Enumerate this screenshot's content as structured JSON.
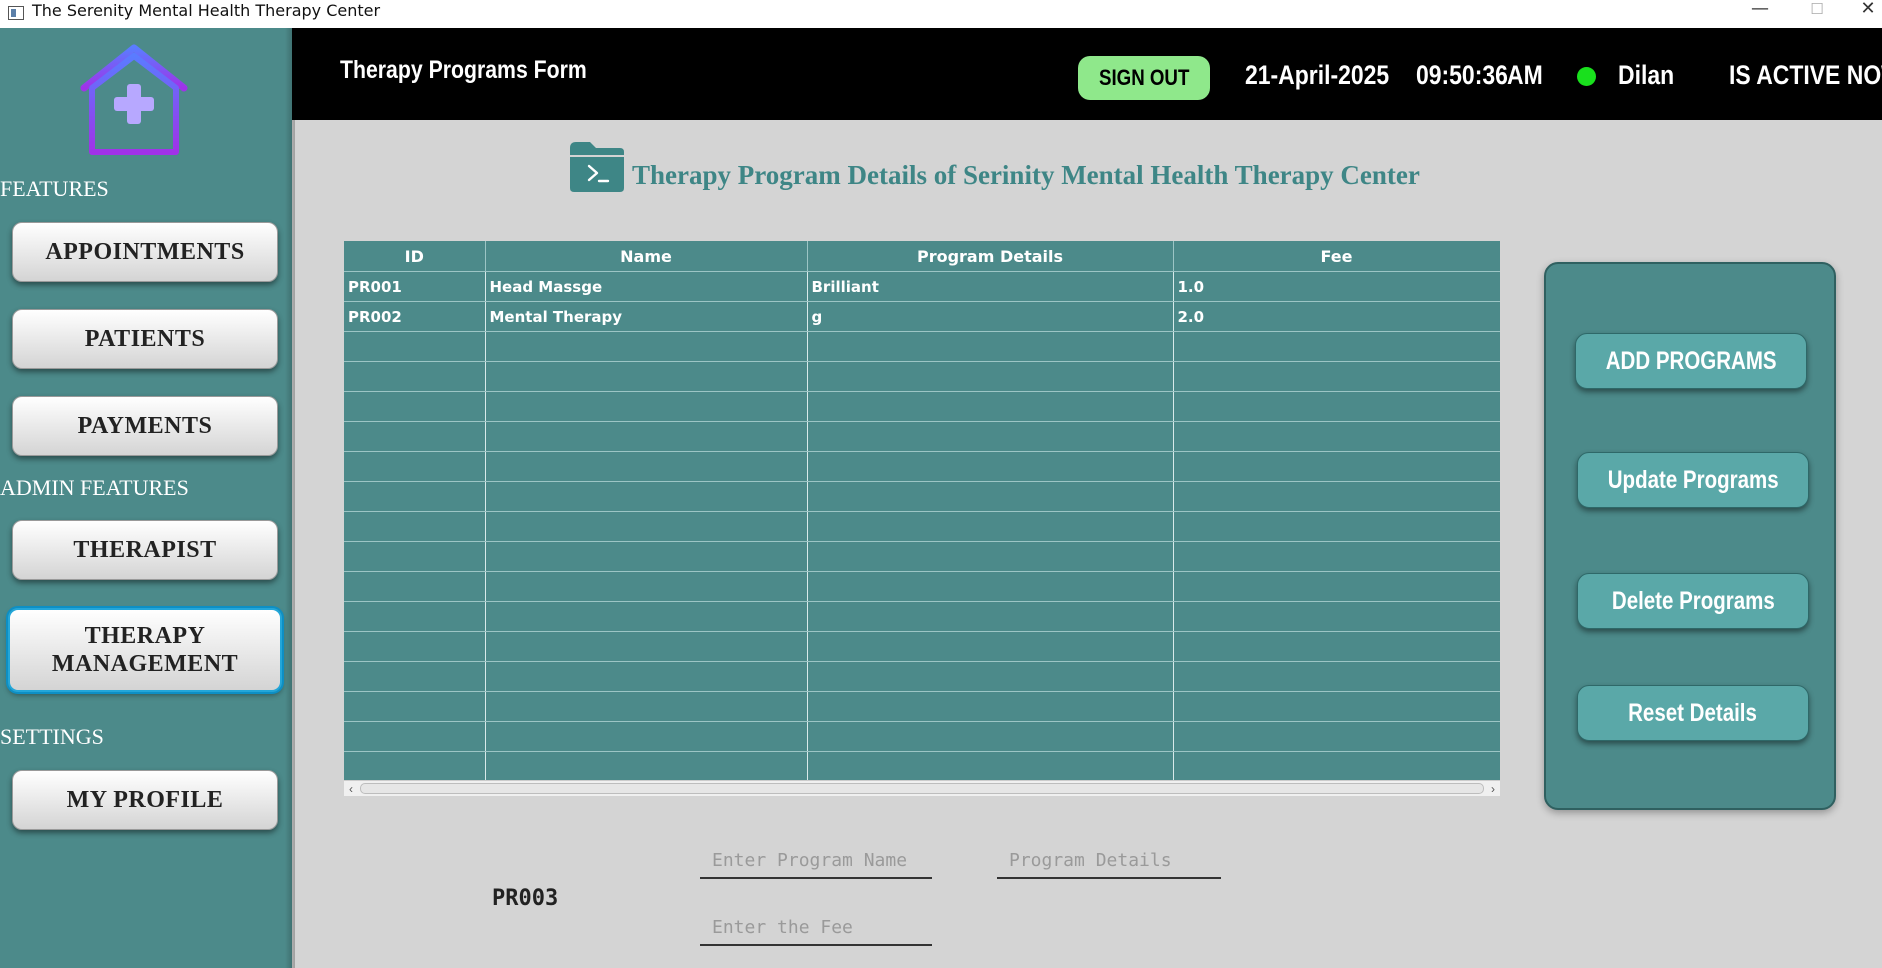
{
  "window": {
    "title": "The Serenity Mental Health Therapy Center",
    "minimize": "—",
    "maximize": "☐",
    "close": "✕"
  },
  "sidebar": {
    "sections": {
      "features": "FEATURES",
      "admin": "ADMIN FEATURES",
      "settings": "SETTINGS"
    },
    "items": [
      {
        "label": "APPOINTMENTS"
      },
      {
        "label": "PATIENTS"
      },
      {
        "label": "PAYMENTS"
      },
      {
        "label": "THERAPIST"
      },
      {
        "label": "THERAPY MANAGEMENT",
        "active": true
      },
      {
        "label": "MY PROFILE"
      }
    ]
  },
  "header": {
    "form_title": "Therapy Programs Form",
    "signout_label": "SIGN OUT",
    "date": "21-April-2025",
    "time": "09:50:36",
    "ampm": "AM",
    "user": "Dilan",
    "status": "IS ACTIVE NOW",
    "status_color": "#19e01d"
  },
  "main": {
    "title": "Therapy Program Details of Serinity Mental Health Therapy Center"
  },
  "table": {
    "columns": [
      "ID",
      "Name",
      "Program Details",
      "Fee"
    ],
    "rows": [
      [
        "PR001",
        "Head Massge",
        "Brilliant",
        "1.0"
      ],
      [
        "PR002",
        "Mental Therapy",
        "g",
        "2.0"
      ]
    ],
    "empty_rows": 15
  },
  "actions": {
    "add": "ADD PROGRAMS",
    "update": "Update Programs",
    "delete": "Delete Programs",
    "reset": "Reset Details"
  },
  "form": {
    "program_id": "PR003",
    "name_placeholder": "Enter Program Name",
    "details_placeholder": "Program Details",
    "fee_placeholder": "Enter the Fee"
  },
  "colors": {
    "teal": "#4c8a8a",
    "button_teal": "#5aa8a8",
    "signout": "#8fe88b"
  }
}
